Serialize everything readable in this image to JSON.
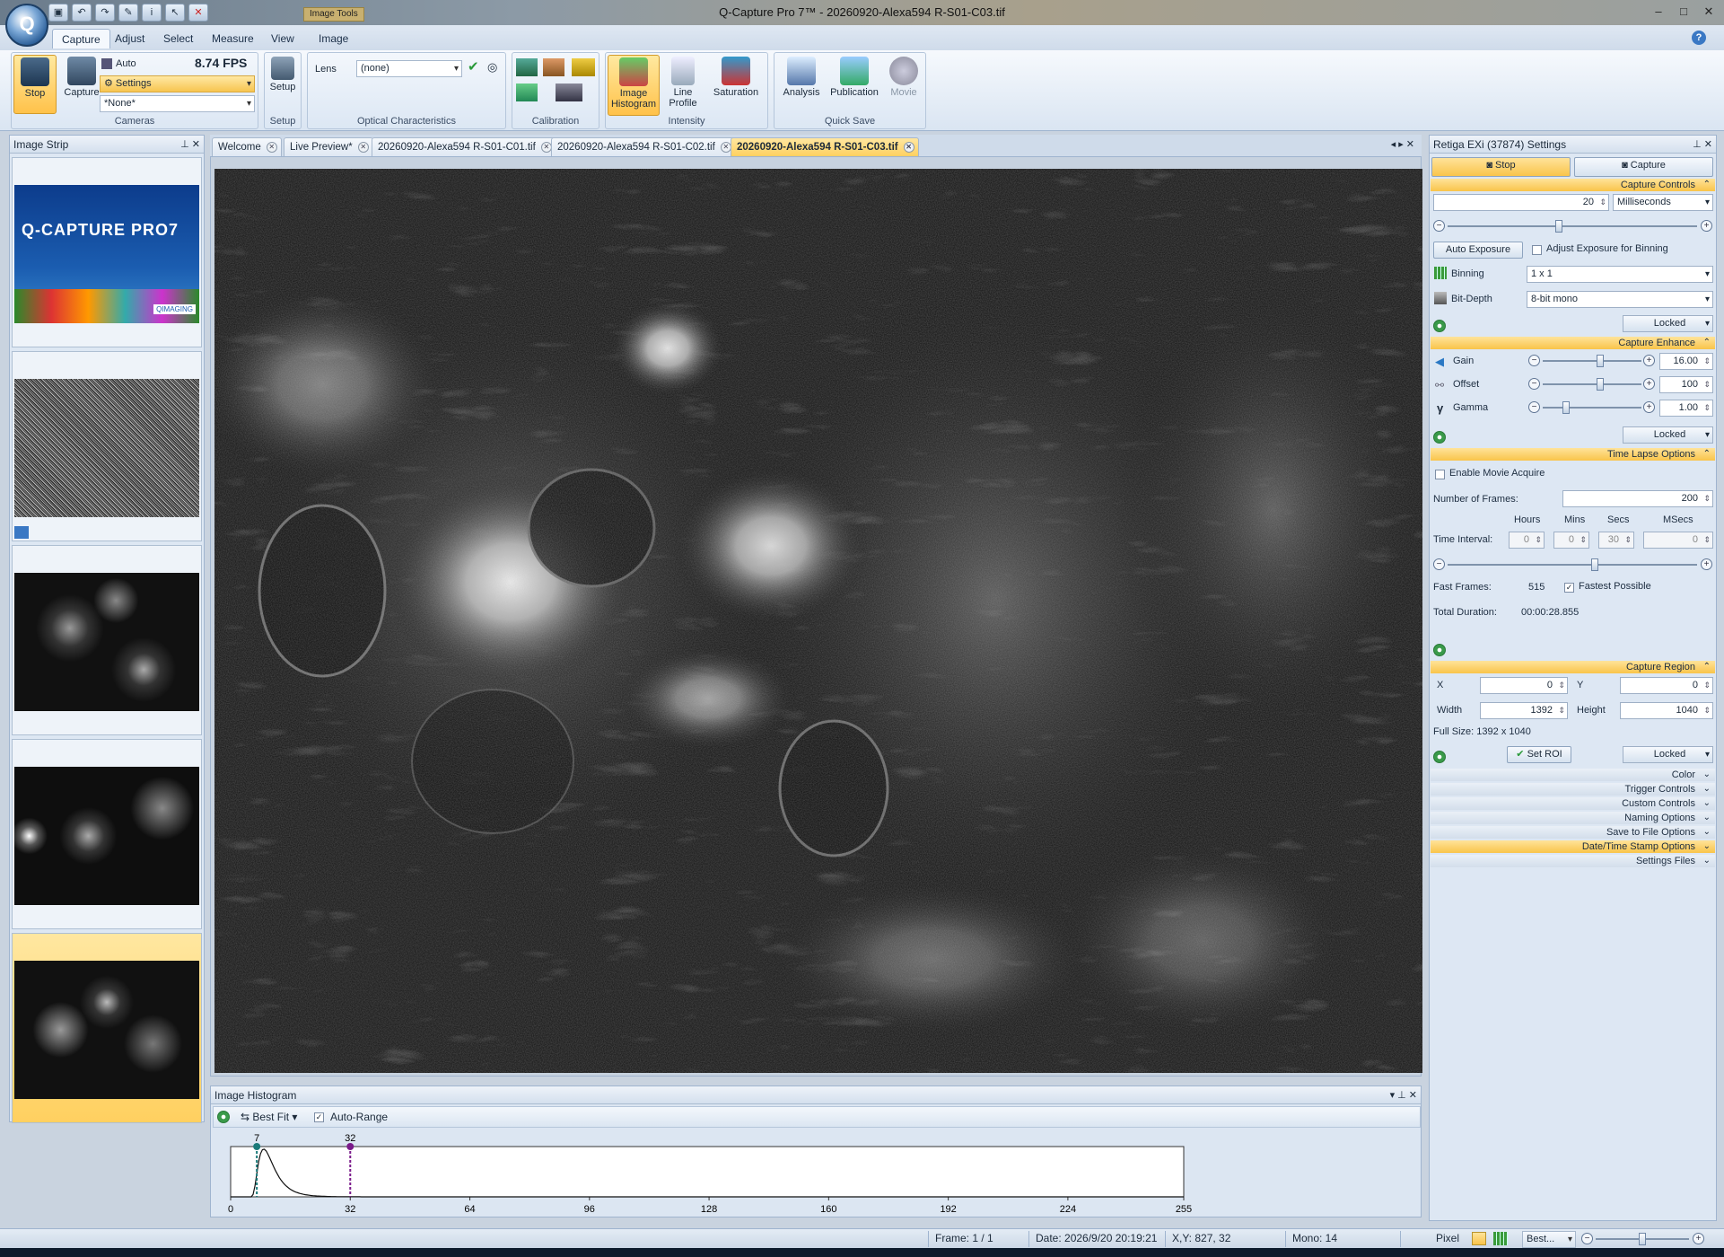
{
  "window": {
    "title": "Q-Capture Pro 7™ - 20260920-Alexa594 R-S01-C03.tif",
    "context_tab": "Image Tools",
    "app_button": "Q"
  },
  "ribbon_tabs": [
    "Capture",
    "Adjust",
    "Select",
    "Measure",
    "View",
    "Image"
  ],
  "ribbon": {
    "stop_label": "Stop",
    "capture_label": "Capture",
    "auto_exposure_label": "Auto Exposure",
    "fps": "8.74 FPS",
    "settings_label": "Settings",
    "none_label": "*None*",
    "cameras_group": "Cameras",
    "setup_label": "Setup",
    "setup_group": "Setup",
    "lens_label": "Lens",
    "lens_value": "(none)",
    "optical_group": "Optical Characteristics",
    "calibration_group": "Calibration",
    "image_histogram_label": "Image Histogram",
    "line_profile_label": "Line Profile",
    "saturation_label": "Saturation",
    "intensity_group": "Intensity",
    "analysis_label": "Analysis",
    "publication_label": "Publication",
    "movie_label": "Movie",
    "quick_save_group": "Quick Save"
  },
  "image_strip": {
    "title": "Image Strip",
    "splash_title": "Q-CAPTURE PRO7",
    "splash_sub": "QIMAGING"
  },
  "doc_tabs": [
    "Welcome",
    "Live Preview*",
    "20260920-Alexa594 R-S01-C01.tif",
    "20260920-Alexa594 R-S01-C02.tif",
    "20260920-Alexa594 R-S01-C03.tif"
  ],
  "histogram": {
    "title": "Image Histogram",
    "best_fit": "Best Fit",
    "auto_range": "Auto-Range",
    "marker_low": "7",
    "marker_high": "32",
    "ticks": [
      "0",
      "32",
      "64",
      "96",
      "128",
      "160",
      "192",
      "224",
      "255"
    ]
  },
  "settings": {
    "title": "Retiga EXi (37874) Settings",
    "stop": "Stop",
    "capture": "Capture",
    "capture_controls": "Capture Controls",
    "exposure_value": "20",
    "exposure_unit": "Milliseconds",
    "auto_exposure": "Auto Exposure",
    "adjust_binning": "Adjust Exposure for Binning",
    "binning_label": "Binning",
    "binning_value": "1 x 1",
    "bitdepth_label": "Bit-Depth",
    "bitdepth_value": "8-bit mono",
    "locked": "Locked",
    "capture_enhance": "Capture Enhance",
    "gain_label": "Gain",
    "gain_value": "16.00",
    "offset_label": "Offset",
    "offset_value": "100",
    "gamma_label": "Gamma",
    "gamma_value": "1.00",
    "time_lapse": "Time Lapse Options",
    "enable_movie": "Enable Movie Acquire",
    "num_frames_label": "Number of Frames:",
    "num_frames_value": "200",
    "hours": "Hours",
    "mins": "Mins",
    "secs": "Secs",
    "msecs": "MSecs",
    "time_interval_label": "Time Interval:",
    "ti_hours": "0",
    "ti_mins": "0",
    "ti_secs": "30",
    "ti_msecs": "0",
    "fast_frames_label": "Fast Frames:",
    "fast_frames_value": "515",
    "fastest_possible": "Fastest Possible",
    "total_duration_label": "Total Duration:",
    "total_duration_value": "00:00:28.855",
    "capture_region": "Capture Region",
    "x_label": "X",
    "x_value": "0",
    "y_label": "Y",
    "y_value": "0",
    "width_label": "Width",
    "width_value": "1392",
    "height_label": "Height",
    "height_value": "1040",
    "full_size": "Full Size: 1392 x 1040",
    "set_roi": "Set ROI",
    "collapsed": [
      "Color",
      "Trigger Controls",
      "Custom Controls",
      "Naming Options",
      "Save to File Options",
      "Date/Time Stamp Options",
      "Settings Files"
    ]
  },
  "status": {
    "frame": "Frame: 1 / 1",
    "date": "Date: 2026/9/20 20:19:21",
    "xy": "X,Y:  827,    32",
    "mono": "Mono:    14",
    "pixel": "Pixel",
    "best": "Best..."
  },
  "colors": {
    "accent": "#f9c44a",
    "ribbon_blue": "#dae5f2",
    "marker_low": "#1a7a7a",
    "marker_high": "#7a1a8a"
  }
}
